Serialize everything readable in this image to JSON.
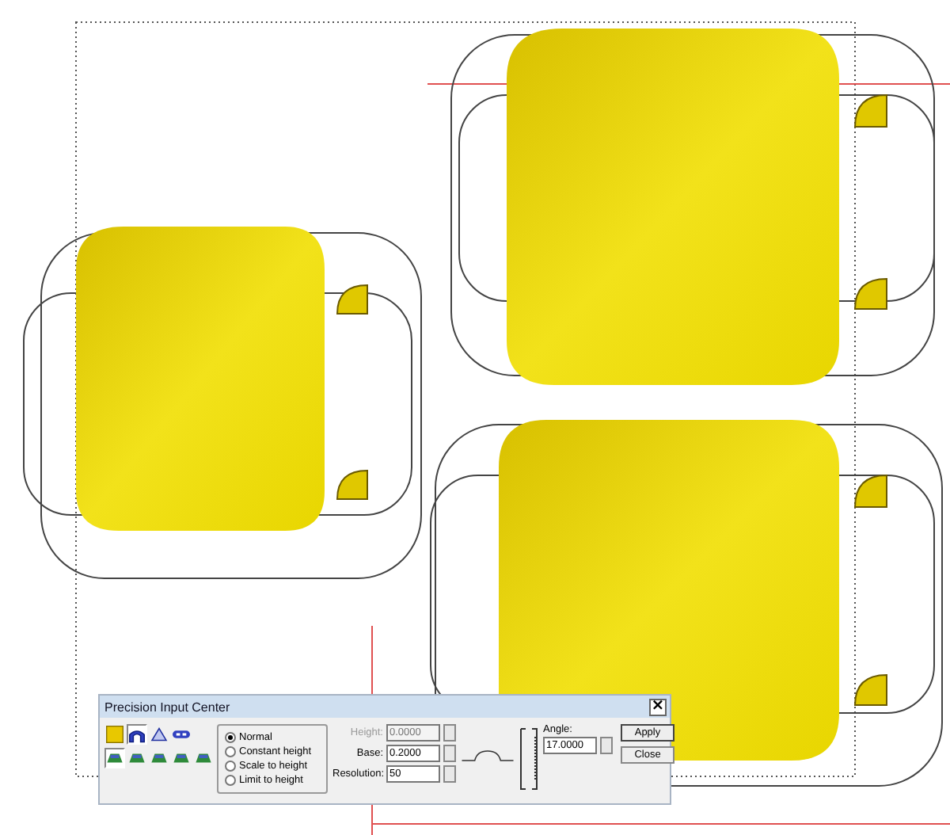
{
  "dialog": {
    "title": "Precision Input Center",
    "close": "×",
    "tools": [
      [
        {
          "kind": "color",
          "selected": false
        },
        {
          "kind": "arch",
          "selected": true
        },
        {
          "kind": "dome",
          "selected": false
        },
        {
          "kind": "link",
          "selected": false
        }
      ],
      [
        {
          "kind": "green",
          "selected": true
        },
        {
          "kind": "green",
          "selected": false
        },
        {
          "kind": "green",
          "selected": false
        },
        {
          "kind": "green",
          "selected": false
        },
        {
          "kind": "green",
          "selected": false
        }
      ]
    ],
    "modes": [
      {
        "label": "Normal",
        "selected": true
      },
      {
        "label": "Constant height",
        "selected": false
      },
      {
        "label": "Scale to height",
        "selected": false
      },
      {
        "label": "Limit to height",
        "selected": false
      }
    ],
    "fields": [
      {
        "label": "Height:",
        "value": "0.0000",
        "disabled": true
      },
      {
        "label": "Base:",
        "value": "0.2000",
        "disabled": false
      },
      {
        "label": "Resolution:",
        "value": "50",
        "disabled": false
      }
    ],
    "angle": {
      "label": "Angle:",
      "value": "17.0000"
    },
    "buttons": [
      "Apply",
      "Close"
    ]
  }
}
